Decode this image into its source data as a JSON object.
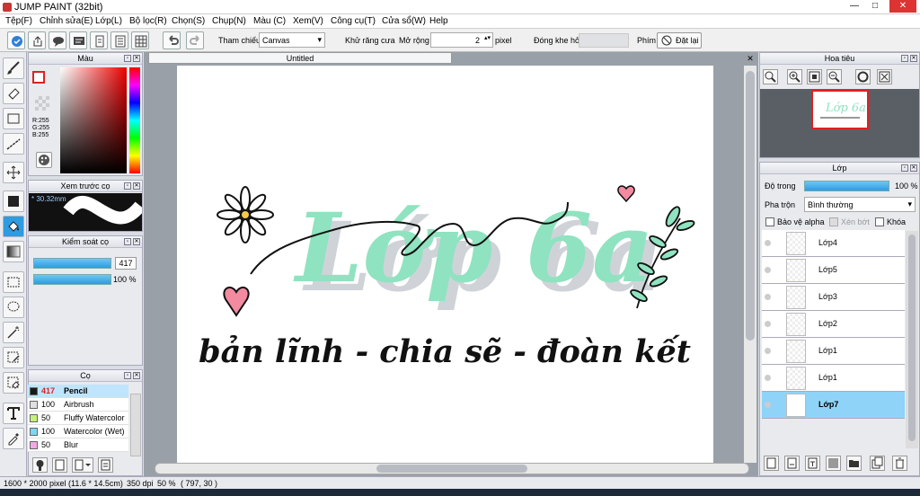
{
  "window": {
    "title": "JUMP PAINT (32bit)"
  },
  "menu": [
    "Tệp(F)",
    "Chỉnh sửa(E)",
    "Lớp(L)",
    "Bộ lọc(R)",
    "Chọn(S)",
    "Chụp(N)",
    "Màu (C)",
    "Xem(V)",
    "Công cụ(T)",
    "Cửa sổ(W)",
    "Help"
  ],
  "toolbar": {
    "reference_label": "Tham chiếu",
    "reference_value": "Canvas",
    "antialias_label": "Khử răng cưa",
    "expand_label": "Mở rộng",
    "expand_value": "2",
    "expand_unit": "pixel",
    "close_gap_label": "Đóng khe hở",
    "key_label": "Phím",
    "reset_label": "Đặt lại"
  },
  "color_panel": {
    "title": "Màu",
    "r": "R:255",
    "g": "G:255",
    "b": "B:255"
  },
  "preview_panel": {
    "title": "Xem trước cọ",
    "size": "30.32mm"
  },
  "control_panel": {
    "title": "Kiểm soát cọ",
    "size": "417",
    "opacity": "100 %"
  },
  "brush_panel": {
    "title": "Cọ",
    "brushes": [
      {
        "size": "417",
        "name": "Pencil",
        "color": "#1a1a1a",
        "active": true
      },
      {
        "size": "100",
        "name": "Airbrush",
        "color": "#e0e0e0",
        "active": false
      },
      {
        "size": "50",
        "name": "Fluffy Watercolor",
        "color": "#c6f07a",
        "active": false
      },
      {
        "size": "100",
        "name": "Watercolor (Wet)",
        "color": "#7fd6f2",
        "active": false
      },
      {
        "size": "50",
        "name": "Blur",
        "color": "#f4a6e6",
        "active": false
      }
    ]
  },
  "document": {
    "tab": "Untitled"
  },
  "artwork": {
    "title_text": "Lớp 6a",
    "subtitle_text": "bản lĩnh - chia sẽ - đoàn kết",
    "mint": "#8fe3c0",
    "shadow": "#cfd3d8"
  },
  "navigator_panel": {
    "title": "Hoa tiêu"
  },
  "layer_panel": {
    "title": "Lớp",
    "opacity_label": "Độ trong",
    "opacity_value": "100 %",
    "blend_label": "Pha trộn",
    "blend_value": "Bình thường",
    "protect_alpha": "Bảo vệ alpha",
    "clipping": "Xén bớt",
    "lock": "Khóa",
    "layers": [
      {
        "name": "Lớp4",
        "active": false
      },
      {
        "name": "Lớp5",
        "active": false
      },
      {
        "name": "Lớp3",
        "active": false
      },
      {
        "name": "Lớp2",
        "active": false
      },
      {
        "name": "Lớp1",
        "active": false
      },
      {
        "name": "Lớp1",
        "active": false
      },
      {
        "name": "Lớp7",
        "active": true
      }
    ]
  },
  "status": {
    "dimensions": "1600 * 2000 pixel",
    "size_cm": "(11.6 * 14.5cm)",
    "dpi": "350 dpi",
    "zoom": "50 %",
    "cursor": "( 797, 30 )"
  },
  "colors": {
    "accent": "#2f9be0",
    "active_layer": "#8fd3f8",
    "panel": "#e8eaee"
  }
}
